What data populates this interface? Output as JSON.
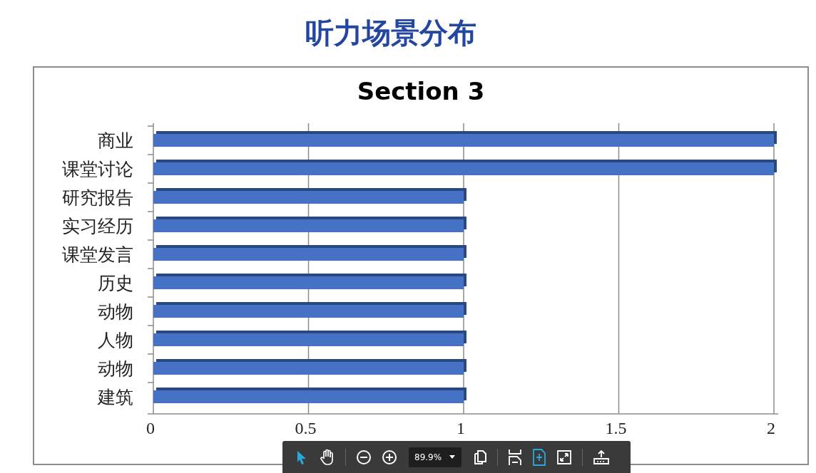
{
  "page_title": "听力场景分布",
  "chart": {
    "chart_data": {
      "type": "bar",
      "orientation": "horizontal",
      "title": "Section 3",
      "categories": [
        "商业",
        "课堂讨论",
        "研究报告",
        "实习经历",
        "课堂发言",
        "历史",
        "动物",
        "人物",
        "动物",
        "建筑"
      ],
      "series": [
        {
          "color": "#4472c4",
          "values": [
            2,
            2,
            1,
            1,
            1,
            1,
            1,
            1,
            1,
            1
          ]
        }
      ],
      "xlim": [
        0,
        2
      ],
      "grid": true,
      "xticks": [
        0,
        0.5,
        1,
        1.5,
        2
      ]
    }
  },
  "toolbar": {
    "groups": [
      [
        {
          "kind": "pointer",
          "selected": true
        },
        {
          "kind": "hand",
          "selected": false
        }
      ],
      [
        {
          "kind": "zoom-out",
          "selected": false
        },
        {
          "kind": "zoom-in",
          "selected": false
        },
        {
          "kind": "zoom",
          "value": "89.9%"
        },
        {
          "kind": "pages",
          "selected": false
        }
      ],
      [
        {
          "kind": "fit-width",
          "selected": false
        },
        {
          "kind": "fit-page",
          "selected": true
        },
        {
          "kind": "fullscreen",
          "selected": false
        }
      ],
      [
        {
          "kind": "upload",
          "selected": false
        }
      ]
    ]
  }
}
